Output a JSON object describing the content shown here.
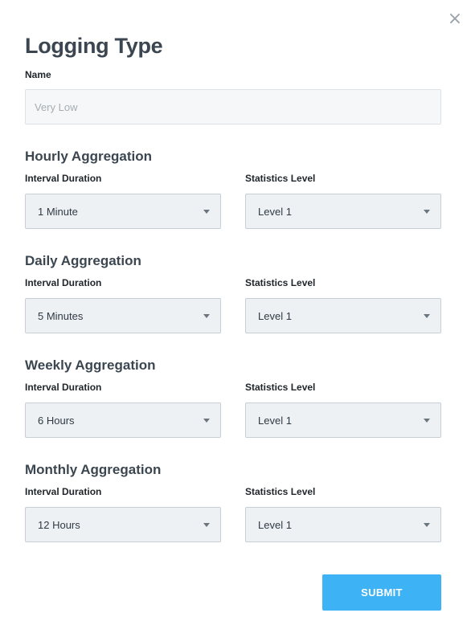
{
  "modal": {
    "title": "Logging Type",
    "close_label": "×",
    "name_label": "Name",
    "name_placeholder": "Very Low",
    "name_value": ""
  },
  "sections": [
    {
      "title": "Hourly Aggregation",
      "interval_label": "Interval Duration",
      "interval_value": "1 Minute",
      "stats_label": "Statistics Level",
      "stats_value": "Level 1"
    },
    {
      "title": "Daily Aggregation",
      "interval_label": "Interval Duration",
      "interval_value": "5 Minutes",
      "stats_label": "Statistics Level",
      "stats_value": "Level 1"
    },
    {
      "title": "Weekly Aggregation",
      "interval_label": "Interval Duration",
      "interval_value": "6 Hours",
      "stats_label": "Statistics Level",
      "stats_value": "Level 1"
    },
    {
      "title": "Monthly Aggregation",
      "interval_label": "Interval Duration",
      "interval_value": "12 Hours",
      "stats_label": "Statistics Level",
      "stats_value": "Level 1"
    }
  ],
  "submit_label": "SUBMIT",
  "colors": {
    "accent": "#3db2f5",
    "title_text": "#3b4650",
    "select_bg": "#eef1f4"
  }
}
